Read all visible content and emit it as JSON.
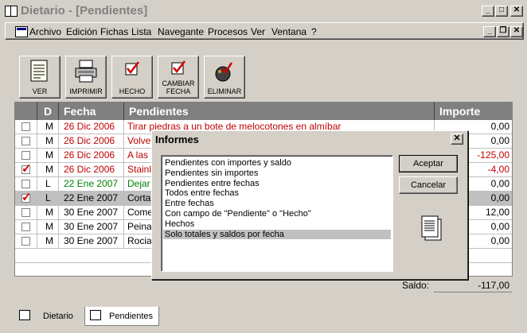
{
  "window": {
    "title": "Dietario - [Pendientes]"
  },
  "menu": [
    {
      "label": "Archivo"
    },
    {
      "label": "Edición"
    },
    {
      "label": "Fichas"
    },
    {
      "label": "Lista"
    },
    {
      "label": "Navegante"
    },
    {
      "label": "Procesos"
    },
    {
      "label": "Ver"
    },
    {
      "label": "Ventana"
    },
    {
      "label": "?"
    }
  ],
  "toolbar": {
    "ver": "VER",
    "imprimir": "IMPRIMIR",
    "hecho": "HECHO",
    "cambiar_fecha_1": "CAMBIAR",
    "cambiar_fecha_2": "FECHA",
    "eliminar": "ELIMINAR"
  },
  "grid": {
    "headers": {
      "check": "",
      "d": "D",
      "fecha": "Fecha",
      "pendientes": "Pendientes",
      "importe": "Importe"
    },
    "rows": [
      {
        "checked": false,
        "d": "M",
        "fecha": "26 Dic 2006",
        "text": "Tirar piedras a un bote de melocotones en almíbar",
        "importe": "0,00",
        "color": "red"
      },
      {
        "checked": false,
        "d": "M",
        "fecha": "26 Dic 2006",
        "text": "Volver",
        "importe": "0,00",
        "color": "red"
      },
      {
        "checked": false,
        "d": "M",
        "fecha": "26 Dic 2006",
        "text": "A las",
        "importe": "-125,00",
        "color": "red"
      },
      {
        "checked": true,
        "d": "M",
        "fecha": "26 Dic 2006",
        "text": "Stainl",
        "importe": "-4,00",
        "color": "red"
      },
      {
        "checked": false,
        "d": "L",
        "fecha": "22 Ene 2007",
        "text": "Dejar",
        "importe": "0,00",
        "color": "green"
      },
      {
        "checked": true,
        "d": "L",
        "fecha": "22 Ene 2007",
        "text": "Corta",
        "importe": "0,00",
        "color": "black"
      },
      {
        "checked": false,
        "d": "M",
        "fecha": "30 Ene 2007",
        "text": "Come",
        "importe": "12,00",
        "color": "black"
      },
      {
        "checked": false,
        "d": "M",
        "fecha": "30 Ene 2007",
        "text": "Peina",
        "importe": "0,00",
        "color": "black"
      },
      {
        "checked": false,
        "d": "M",
        "fecha": "30 Ene 2007",
        "text": "Rocia",
        "importe": "0,00",
        "color": "black"
      }
    ]
  },
  "saldo": {
    "label": "Saldo:",
    "value": "-117,00"
  },
  "tabs": [
    {
      "label": "Dietario"
    },
    {
      "label": "Pendientes"
    }
  ],
  "dialog": {
    "title": "Informes",
    "options": [
      "Pendientes con importes y saldo",
      "Pendientes sin importes",
      "Pendientes entre fechas",
      "Todos entre fechas",
      "Entre fechas",
      "Con campo de \"Pendiente\" o \"Hecho\"",
      "Hechos",
      "Solo totales y saldos por fecha"
    ],
    "selected_index": 7,
    "accept": "Aceptar",
    "cancel": "Cancelar"
  },
  "colors": {
    "red_text": "#c00000",
    "green_text": "#008000",
    "header_bg": "#808080",
    "face": "#d4d0c8"
  }
}
